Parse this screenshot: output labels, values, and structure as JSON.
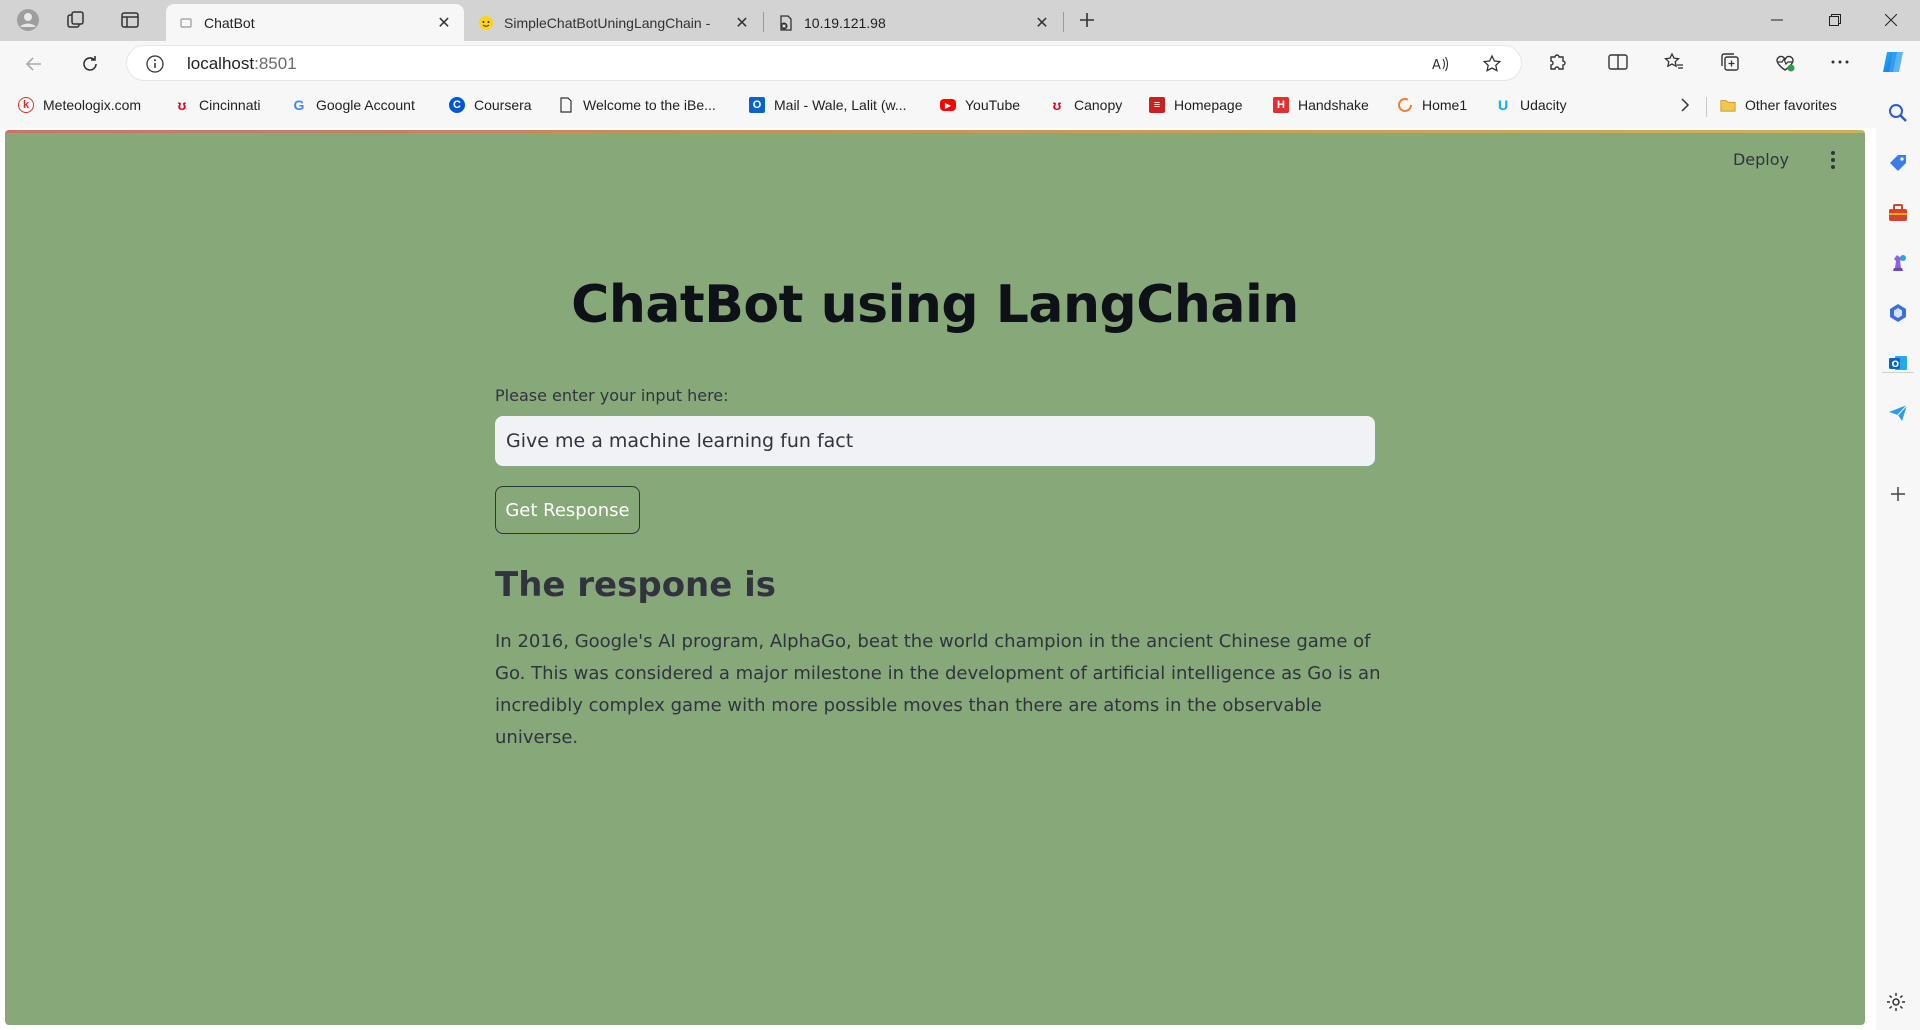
{
  "browser": {
    "tabs": [
      {
        "title": "ChatBot",
        "active": true
      },
      {
        "title": "SimpleChatBotUningLangChain -",
        "active": false
      },
      {
        "title": "10.19.121.98",
        "active": false
      }
    ],
    "address": {
      "host": "localhost",
      "port": ":8501"
    }
  },
  "favorites": [
    {
      "label": "Meteologix.com",
      "icon": "meteologix-icon",
      "color": "#d93025"
    },
    {
      "label": "Cincinnati",
      "icon": "uc-icon",
      "color": "#e00122"
    },
    {
      "label": "Google Account",
      "icon": "google-icon",
      "color": "#4285f4"
    },
    {
      "label": "Coursera",
      "icon": "coursera-icon",
      "color": "#0056d2"
    },
    {
      "label": "Welcome to the iBe...",
      "icon": "page-icon",
      "color": "#555555"
    },
    {
      "label": "Mail - Wale, Lalit (w...",
      "icon": "outlook-icon",
      "color": "#0a64c2"
    },
    {
      "label": "YouTube",
      "icon": "youtube-icon",
      "color": "#ff0000"
    },
    {
      "label": "Canopy",
      "icon": "uc-icon",
      "color": "#e00122"
    },
    {
      "label": "Homepage",
      "icon": "homepage-icon",
      "color": "#cc1f1f"
    },
    {
      "label": "Handshake",
      "icon": "handshake-icon",
      "color": "#e0312f"
    },
    {
      "label": "Home1",
      "icon": "home1-icon",
      "color": "#f07f2a"
    },
    {
      "label": "Udacity",
      "icon": "udacity-icon",
      "color": "#02b3e4"
    }
  ],
  "other_favorites": "Other favorites",
  "app": {
    "deploy_label": "Deploy",
    "title": "ChatBot using LangChain",
    "input_label": "Please enter your input here:",
    "input_value": "Give me a machine learning fun fact",
    "button_label": "Get Response",
    "response_heading": "The respone is",
    "response_text": "In 2016, Google's AI program, AlphaGo, beat the world champion in the ancient Chinese game of Go. This was considered a major milestone in the development of artificial intelligence as Go is an incredibly complex game with more possible moves than there are atoms in the observable universe.",
    "background_color": "#87a878"
  }
}
